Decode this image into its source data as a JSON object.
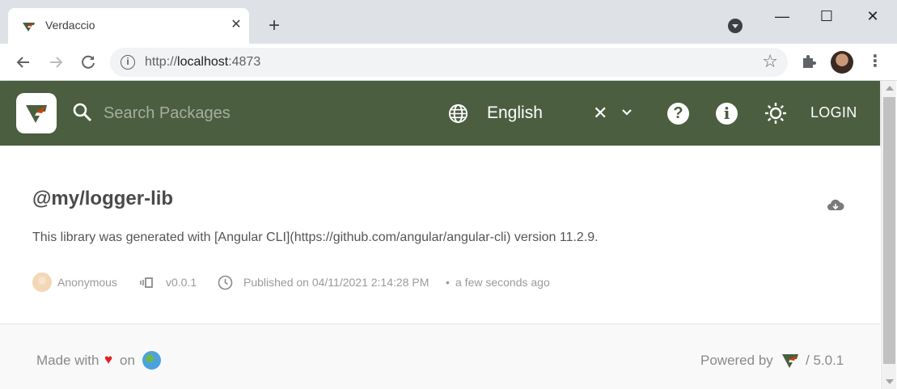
{
  "browser": {
    "tab_title": "Verdaccio",
    "tab_close": "✕",
    "new_tab": "+",
    "url_scheme": "http://",
    "url_host": "localhost",
    "url_port": ":4873",
    "window_controls": {
      "minimize": "—",
      "maximize": "☐",
      "close": "✕"
    },
    "icons": [
      "back-icon",
      "forward-icon",
      "reload-icon",
      "info-icon",
      "star-icon",
      "extensions-icon",
      "profile-avatar",
      "menu-icon"
    ]
  },
  "header": {
    "search_placeholder": "Search Packages",
    "language": "English",
    "clear_symbol": "✕",
    "help_symbol": "?",
    "info_symbol": "i",
    "login_label": "LOGIN",
    "brand_color": "#4b5e40"
  },
  "package": {
    "name": "@my/logger-lib",
    "description": "This library was generated with [Angular CLI](https://github.com/angular/angular-cli) version 11.2.9.",
    "author": "Anonymous",
    "version": "v0.0.1",
    "published": "Published on 04/11/2021 2:14:28 PM",
    "separator": "•",
    "relative_time": "a few seconds ago"
  },
  "footer": {
    "made_with": "Made with",
    "heart": "♥",
    "on": "on",
    "powered_by": "Powered by",
    "version": "/ 5.0.1"
  }
}
